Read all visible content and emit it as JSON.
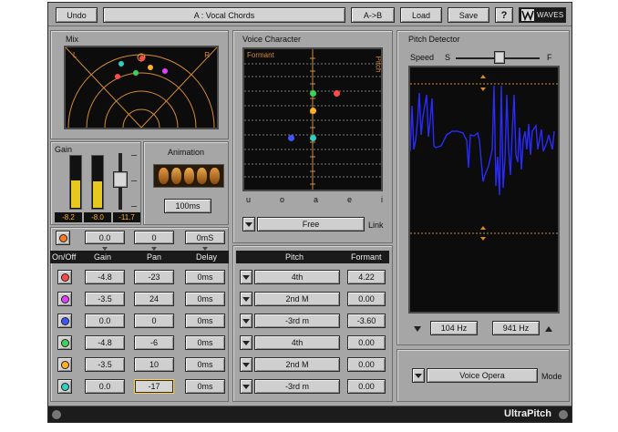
{
  "toolbar": {
    "undo_label": "Undo",
    "preset_name": "A : Vocal Chords",
    "ab_label": "A->B",
    "load_label": "Load",
    "save_label": "Save",
    "help_label": "?",
    "brand_label": "WAVES"
  },
  "mix": {
    "title": "Mix",
    "left_label": "L",
    "right_label": "R"
  },
  "gain": {
    "title": "Gain",
    "meter_left_value": "-8.2",
    "meter_right_value": "-8.0",
    "fader_value": "-11.7",
    "meter_left_level": 0.52,
    "meter_right_level": 0.5
  },
  "animation": {
    "title": "Animation",
    "time_value": "100ms"
  },
  "voice_character": {
    "title": "Voice Character",
    "formant_label": "Formant",
    "pitch_label": "Pitch",
    "vowels": [
      "u",
      "o",
      "a",
      "e",
      "i"
    ],
    "mode_value": "Free",
    "link_label": "Link"
  },
  "pitch_detector": {
    "title": "Pitch Detector",
    "speed_label": "Speed",
    "slow_label": "S",
    "fast_label": "F",
    "low_freq": "104 Hz",
    "high_freq": "941 Hz"
  },
  "master": {
    "gain": "0.0",
    "pan": "0",
    "delay": "0mS"
  },
  "voices_header": {
    "onoff": "On/Off",
    "gain": "Gain",
    "pan": "Pan",
    "delay": "Delay"
  },
  "pitch_header": {
    "pitch": "Pitch",
    "formant": "Formant"
  },
  "voices": [
    {
      "color": "#ff4a4a",
      "gain": "-4.8",
      "pan": "-23",
      "delay": "0ms",
      "pitch": "4th",
      "formant": "4.22"
    },
    {
      "color": "#e040ff",
      "gain": "-3.5",
      "pan": "24",
      "delay": "0ms",
      "pitch": "2nd M",
      "formant": "0.00"
    },
    {
      "color": "#3d54ff",
      "gain": "0.0",
      "pan": "0",
      "delay": "0ms",
      "pitch": "-3rd m",
      "formant": "-3.60"
    },
    {
      "color": "#3bd45a",
      "gain": "-4.8",
      "pan": "-6",
      "delay": "0ms",
      "pitch": "4th",
      "formant": "0.00"
    },
    {
      "color": "#ffb020",
      "gain": "-3.5",
      "pan": "10",
      "delay": "0ms",
      "pitch": "2nd M",
      "formant": "0.00"
    },
    {
      "color": "#2fd0c0",
      "gain": "0.0",
      "pan": "-17",
      "delay": "0ms",
      "pitch": "-3rd m",
      "formant": "0.00"
    }
  ],
  "mode": {
    "value": "Voice Opera",
    "label": "Mode"
  },
  "footer": {
    "product_name": "UltraPitch"
  }
}
